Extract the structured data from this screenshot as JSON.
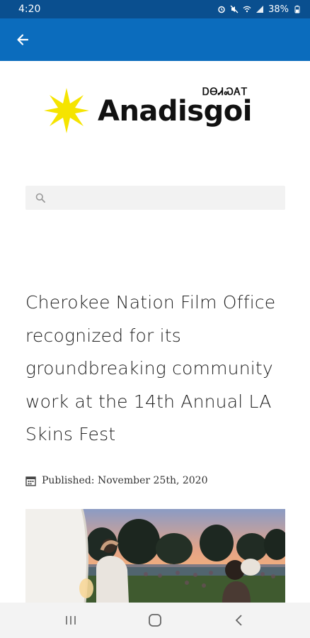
{
  "status_bar": {
    "time": "4:20",
    "battery": "38%",
    "icons": [
      "alarm-icon",
      "mute-icon",
      "wifi-icon",
      "signal-icon",
      "battery-icon"
    ]
  },
  "app_bar": {
    "back_icon": "arrow-left-icon"
  },
  "logo": {
    "main_text": "Anadisgoi",
    "syllabary_text": "ᎠᎾᏗᏍᎪᎢ",
    "star_color": "#f5e400"
  },
  "search": {
    "placeholder": "",
    "value": "",
    "icon": "search-icon"
  },
  "article": {
    "title": "Cherokee Nation Film Office recognized for its groundbreaking community work at the 14th Annual LA Skins Fest",
    "published_label": "Published: November 25th, 2020",
    "published_icon": "calendar-icon"
  },
  "nav_bar": {
    "recents_icon": "recents-icon",
    "home_icon": "home-icon",
    "back_icon": "back-chevron-icon"
  },
  "colors": {
    "status_bar": "#0a4f8f",
    "app_bar": "#0b6cbd"
  }
}
